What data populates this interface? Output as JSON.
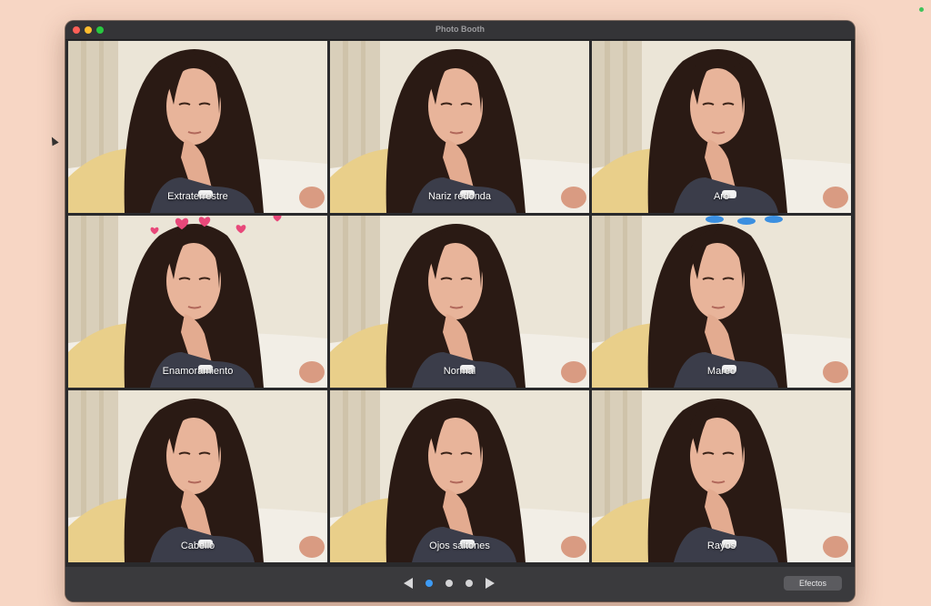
{
  "window": {
    "title": "Photo Booth"
  },
  "effects": [
    {
      "label": "Extraterrestre",
      "overlay": "none"
    },
    {
      "label": "Nariz redonda",
      "overlay": "none"
    },
    {
      "label": "Aro",
      "overlay": "none"
    },
    {
      "label": "Enamoramiento",
      "overlay": "hearts"
    },
    {
      "label": "Normal",
      "overlay": "none"
    },
    {
      "label": "Mareo",
      "overlay": "birds"
    },
    {
      "label": "Cabello",
      "overlay": "none"
    },
    {
      "label": "Ojos saltones",
      "overlay": "none"
    },
    {
      "label": "Rayos",
      "overlay": "none"
    }
  ],
  "toolbar": {
    "effects_button_label": "Efectos",
    "page_count": 3,
    "current_page": 1
  },
  "colors": {
    "desktop": "#f7d6c4",
    "accent": "#3d9bf5",
    "heart": "#e8487a",
    "bird": "#3b8fe0"
  }
}
